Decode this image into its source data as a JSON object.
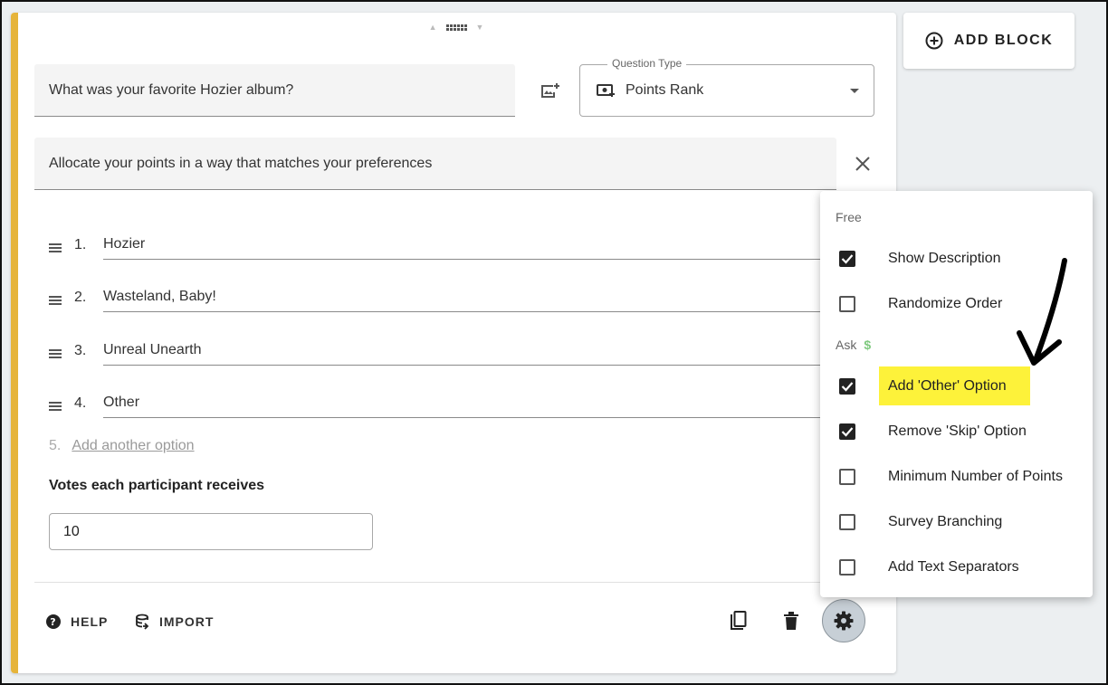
{
  "question": {
    "text": "What was your favorite Hozier album?"
  },
  "question_type": {
    "label": "Question Type",
    "value": "Points Rank"
  },
  "description": {
    "text": "Allocate your points in a way that matches your preferences"
  },
  "options": [
    {
      "num": "1.",
      "text": "Hozier"
    },
    {
      "num": "2.",
      "text": "Wasteland, Baby!"
    },
    {
      "num": "3.",
      "text": "Unreal Unearth"
    },
    {
      "num": "4.",
      "text": "Other"
    }
  ],
  "add_option": {
    "num": "5.",
    "label": "Add another option"
  },
  "votes": {
    "label": "Votes each participant receives",
    "value": "10"
  },
  "footer": {
    "help_label": "HELP",
    "import_label": "IMPORT"
  },
  "add_block": {
    "label": "ADD BLOCK"
  },
  "settings_menu": {
    "free_section": "Free",
    "ask_section": "Ask",
    "ask_badge": "$",
    "items": [
      {
        "label": "Show Description",
        "checked": true
      },
      {
        "label": "Randomize Order",
        "checked": false
      },
      {
        "label": "Add 'Other' Option",
        "checked": true,
        "highlighted": true
      },
      {
        "label": "Remove 'Skip' Option",
        "checked": true
      },
      {
        "label": "Minimum Number of Points",
        "checked": false
      },
      {
        "label": "Survey Branching",
        "checked": false
      },
      {
        "label": "Add Text Separators",
        "checked": false
      }
    ]
  },
  "colors": {
    "accent": "#e6b43a",
    "highlight": "#fdf23a",
    "ask_badge": "#7fc97f"
  }
}
